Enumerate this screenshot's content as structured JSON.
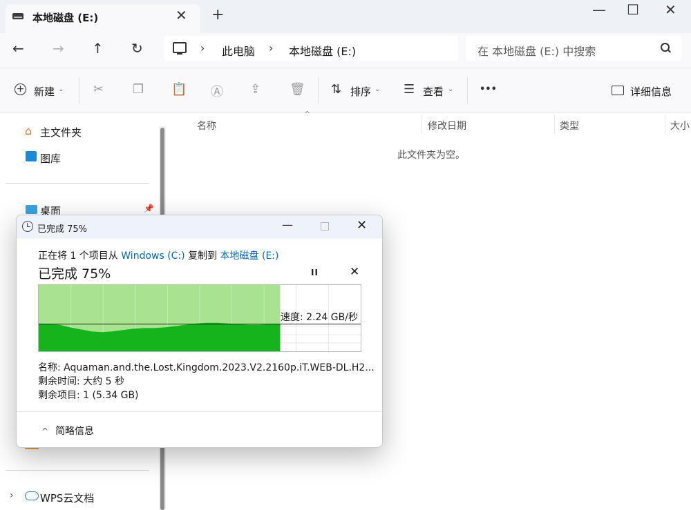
{
  "window": {
    "tab_title": "本地磁盘 (E:)",
    "new_tab_glyph": "+",
    "tab_close_glyph": "✕",
    "minimize_glyph": "—",
    "maximize_glyph": "☐",
    "close_glyph": "✕"
  },
  "address": {
    "breadcrumbs": [
      "此电脑",
      "本地磁盘 (E:)"
    ],
    "separator": "›",
    "search_placeholder": "在 本地磁盘 (E:) 中搜索"
  },
  "nav": {
    "back": "←",
    "forward": "→",
    "up": "↑",
    "refresh": "↻"
  },
  "toolbar": {
    "new_label": "新建",
    "sort_label": "排序",
    "view_label": "查看",
    "more_glyph": "•••",
    "details_label": "详细信息",
    "chevron": "⌄"
  },
  "sidebar": {
    "home": "主文件夹",
    "gallery": "图库",
    "desktop": "桌面",
    "partial_item": "...",
    "wps": "WPS云文档",
    "expand_glyph": "›"
  },
  "columns": {
    "name": "名称",
    "modified": "修改日期",
    "type": "类型",
    "size": "大小",
    "sort_indicator": "^"
  },
  "content": {
    "empty_text": "此文件夹为空。"
  },
  "dialog": {
    "title": "已完成 75%",
    "copy_prefix": "正在将 1 个项目从 ",
    "source": "Windows (C:)",
    "copy_mid": " 复制到 ",
    "destination": "本地磁盘 (E:)",
    "percent_heading": "已完成 75%",
    "progress_fraction": 0.75,
    "pause_glyph": "II",
    "cancel_glyph": "✕",
    "speed": "速度: 2.24 GB/秒",
    "name_line": "名称: Aquaman.and.the.Lost.Kingdom.2023.V2.2160p.iT.WEB-DL.H2...",
    "time_line": "剩余时间: 大约 5 秒",
    "items_line": "剩余项目: 1 (5.34 GB)",
    "details_toggle": "简略信息",
    "details_chevron": "^",
    "minimize_glyph": "—",
    "close_glyph": "✕",
    "throughput_profile": [
      0.42,
      0.41,
      0.4,
      0.36,
      0.33,
      0.3,
      0.29,
      0.3,
      0.32,
      0.34,
      0.35,
      0.35,
      0.36,
      0.38,
      0.4,
      0.42,
      0.43,
      0.43,
      0.42,
      0.41,
      0.4,
      0.4,
      0.41,
      0.41
    ],
    "colors": {
      "transferred_bg": "#a8e38f",
      "throughput_fill": "#14b51c",
      "link": "#0067c0"
    }
  }
}
